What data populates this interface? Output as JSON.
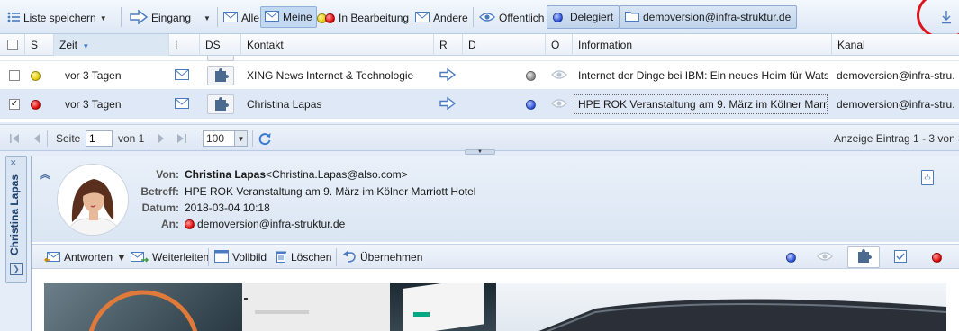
{
  "toolbar": {
    "save_list": "Liste speichern",
    "inbox": "Eingang",
    "all": "Alle",
    "mine": "Meine",
    "in_progress": "In Bearbeitung",
    "others": "Andere",
    "public": "Öffentlich",
    "delegated": "Delegiert",
    "account": "demoversion@infra-struktur.de"
  },
  "grid": {
    "columns": [
      "S",
      "Zeit",
      "I",
      "DS",
      "Kontakt",
      "R",
      "D",
      "Ö",
      "Information",
      "Kanal"
    ],
    "rows": [
      {
        "status": "yellow",
        "time": "vor 3 Tagen",
        "contact": "XING News Internet & Technologie",
        "d_status": "grey",
        "information": "Internet der Dinge bei IBM: Ein neues Heim für Watso...",
        "channel": "demoversion@infra-stru...",
        "checked": false
      },
      {
        "status": "red",
        "time": "vor 3 Tagen",
        "contact": "Christina Lapas",
        "d_status": "blue",
        "information": "HPE ROK Veranstaltung am 9. März im Kölner Marriott...",
        "channel": "demoversion@infra-stru...",
        "checked": true
      }
    ]
  },
  "pager": {
    "page_label": "Seite",
    "page_value": "1",
    "of_label": "von 1",
    "page_size": "100",
    "display_info": "Anzeige Eintrag 1 - 3 von 3"
  },
  "preview": {
    "side_tab": "Christina Lapas",
    "from_label": "Von:",
    "from_name": "Christina Lapas",
    "from_email": "<Christina.Lapas@also.com>",
    "subject_label": "Betreff:",
    "subject": "HPE ROK Veranstaltung am 9. März im Kölner Marriott Hotel",
    "date_label": "Datum:",
    "date": "2018-03-04 10:18",
    "to_label": "An:",
    "to": "demoversion@infra-struktur.de"
  },
  "preview_toolbar": {
    "reply": "Antworten",
    "forward": "Weiterleiten",
    "fullscreen": "Vollbild",
    "delete": "Löschen",
    "take_over": "Übernehmen"
  }
}
